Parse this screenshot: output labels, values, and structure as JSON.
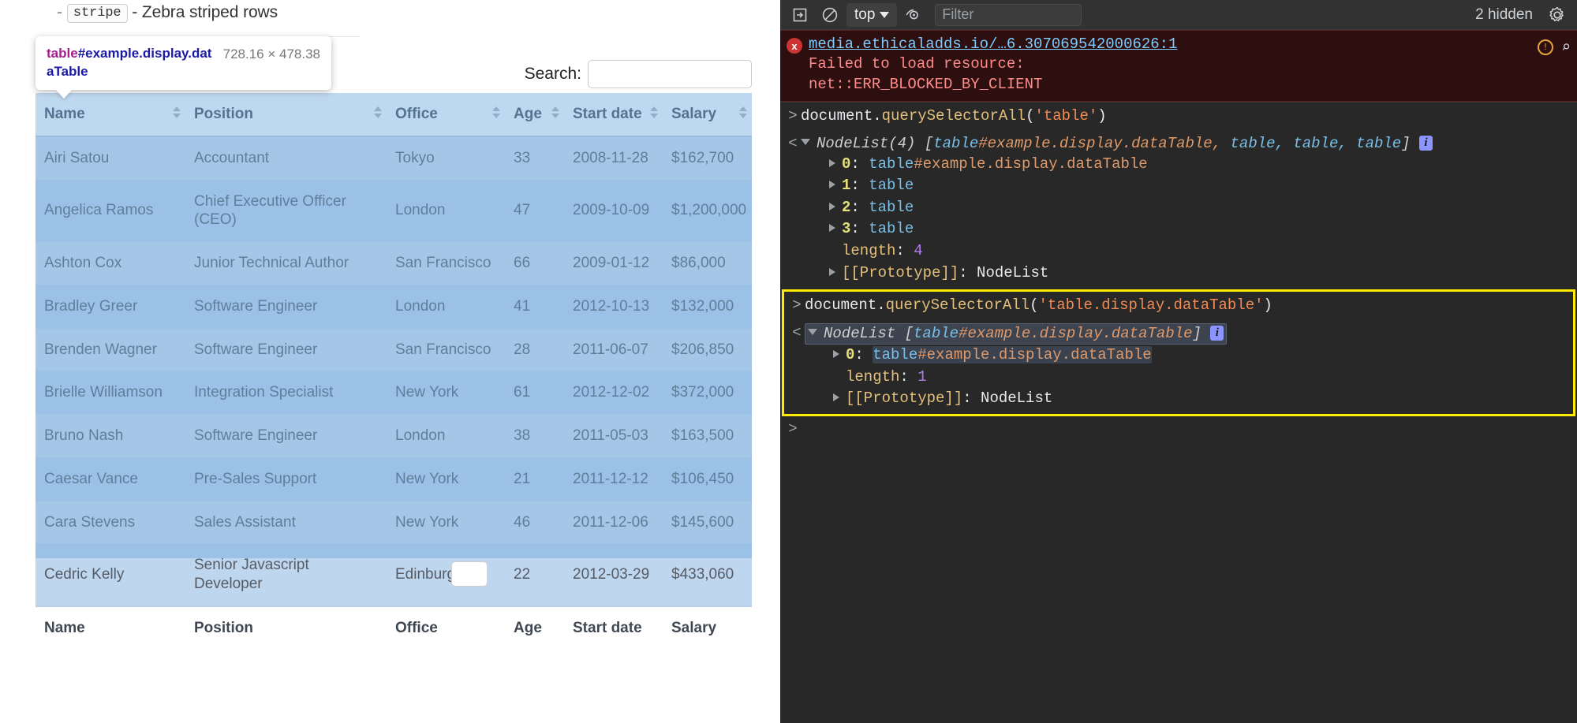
{
  "page": {
    "bullet": {
      "dash": "-",
      "code": "stripe",
      "text": "- Zebra striped rows"
    },
    "datatable": {
      "search_label": "Search:",
      "search_value": "",
      "search_placeholder": "",
      "columns": [
        "Name",
        "Position",
        "Office",
        "Age",
        "Start date",
        "Salary"
      ],
      "rows": [
        [
          "Airi Satou",
          "Accountant",
          "Tokyo",
          "33",
          "2008-11-28",
          "$162,700"
        ],
        [
          "Angelica Ramos",
          "Chief Executive Officer (CEO)",
          "London",
          "47",
          "2009-10-09",
          "$1,200,000"
        ],
        [
          "Ashton Cox",
          "Junior Technical Author",
          "San Francisco",
          "66",
          "2009-01-12",
          "$86,000"
        ],
        [
          "Bradley Greer",
          "Software Engineer",
          "London",
          "41",
          "2012-10-13",
          "$132,000"
        ],
        [
          "Brenden Wagner",
          "Software Engineer",
          "San Francisco",
          "28",
          "2011-06-07",
          "$206,850"
        ],
        [
          "Brielle Williamson",
          "Integration Specialist",
          "New York",
          "61",
          "2012-12-02",
          "$372,000"
        ],
        [
          "Bruno Nash",
          "Software Engineer",
          "London",
          "38",
          "2011-05-03",
          "$163,500"
        ],
        [
          "Caesar Vance",
          "Pre-Sales Support",
          "New York",
          "21",
          "2011-12-12",
          "$106,450"
        ],
        [
          "Cara Stevens",
          "Sales Assistant",
          "New York",
          "46",
          "2011-12-06",
          "$145,600"
        ],
        [
          "Cedric Kelly",
          "Senior Javascript Developer",
          "Edinburgh",
          "22",
          "2012-03-29",
          "$433,060"
        ]
      ],
      "footer": [
        "Name",
        "Position",
        "Office",
        "Age",
        "Start date",
        "Salary"
      ]
    },
    "inspector_tooltip": {
      "tag": "table",
      "id_and_classes": "#example.display.dataTable",
      "size": "728.16 × 478.38"
    },
    "highlight_color": "#6fa8dc"
  },
  "devtools": {
    "toolbar": {
      "execute_icon": "execute-snippet-icon",
      "clear_icon": "clear-console-icon",
      "context": "top",
      "eye_icon": "live-expression-icon",
      "filter_placeholder": "Filter",
      "filter_value": "",
      "hidden_label": "2 hidden",
      "settings_icon": "gear-icon"
    },
    "messages": [
      {
        "type": "error",
        "badge": "x",
        "url": "media.ethicaladds.io/…6.307069542000626:1",
        "lines": [
          "Failed to load resource:",
          "net::ERR_BLOCKED_BY_CLIENT"
        ],
        "icons": [
          "issue-icon",
          "search-icon"
        ]
      },
      {
        "type": "command",
        "gutter": ">",
        "text": "document.querySelectorAll('table')",
        "obj": "document",
        "dot": ".",
        "method": "querySelectorAll",
        "open_paren": "(",
        "arg": "'table'",
        "close_paren": ")"
      },
      {
        "type": "result",
        "gutter": "<",
        "head_prefix": "NodeList(4) [",
        "head_items": [
          "table#example.display.dataTable,",
          "table,",
          "table,",
          "table"
        ],
        "head_suffix": "]",
        "badge": "i",
        "props": [
          {
            "key": "0",
            "value": "table#example.display.dataTable",
            "kind": "node",
            "expandable": true
          },
          {
            "key": "1",
            "value": "table",
            "kind": "node",
            "expandable": true
          },
          {
            "key": "2",
            "value": "table",
            "kind": "node",
            "expandable": true
          },
          {
            "key": "3",
            "value": "table",
            "kind": "node",
            "expandable": true
          },
          {
            "key": "length",
            "value": "4",
            "kind": "number",
            "expandable": false
          },
          {
            "key": "[[Prototype]]",
            "value": "NodeList",
            "kind": "plain",
            "expandable": true
          }
        ]
      },
      {
        "type": "command",
        "highlighted": true,
        "gutter": ">",
        "obj": "document",
        "dot": ".",
        "method": "querySelectorAll",
        "open_paren": "(",
        "arg": "'table.display.dataTable'",
        "close_paren": ")"
      },
      {
        "type": "result",
        "highlighted": true,
        "gutter": "<",
        "head_prefix": "NodeList [",
        "head_items": [
          "table#example.display.dataTable"
        ],
        "head_suffix": "]",
        "badge": "i",
        "props": [
          {
            "key": "0",
            "value": "table#example.display.dataTable",
            "kind": "node",
            "expandable": true
          },
          {
            "key": "length",
            "value": "1",
            "kind": "number",
            "expandable": false
          },
          {
            "key": "[[Prototype]]",
            "value": "NodeList",
            "kind": "plain",
            "expandable": true
          }
        ]
      }
    ],
    "prompt": ">"
  }
}
